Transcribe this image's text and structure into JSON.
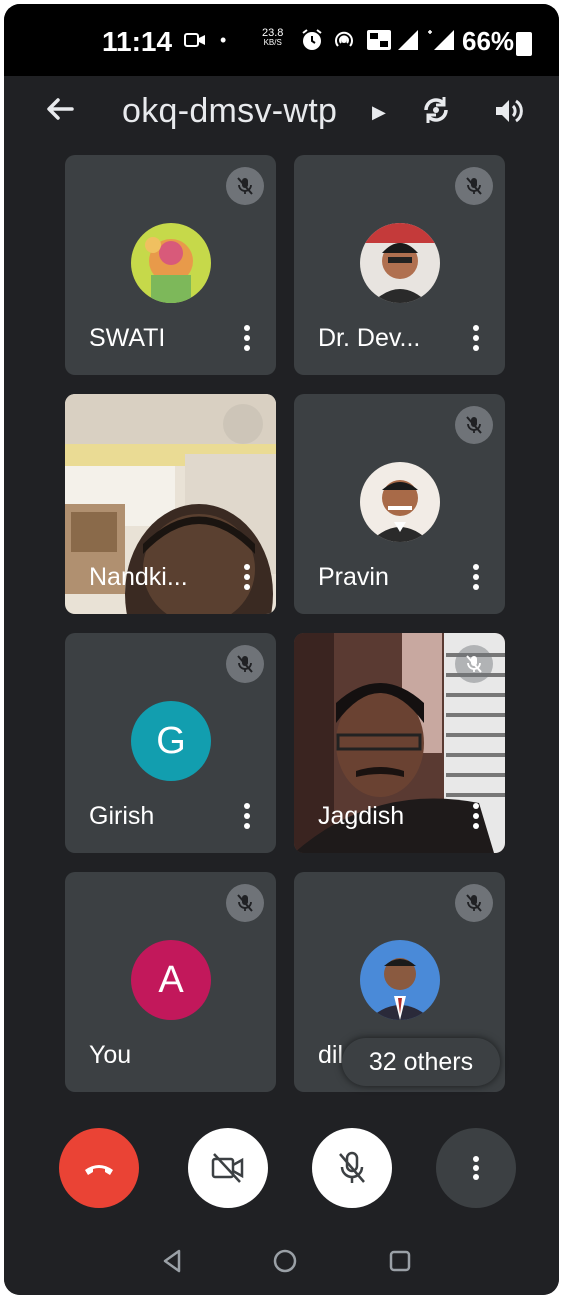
{
  "status_bar": {
    "time": "11:14",
    "speed_value": "23.8",
    "speed_unit": "KB/S",
    "battery": "66%"
  },
  "header": {
    "meeting_code": "okq-dmsv-wtp"
  },
  "participants": [
    {
      "name": "SWATI",
      "avatar_type": "photo",
      "muted": true
    },
    {
      "name": "Dr. Dev...",
      "avatar_type": "photo",
      "muted": true
    },
    {
      "name": "Nandki...",
      "avatar_type": "video",
      "muted": false
    },
    {
      "name": "Pravin",
      "avatar_type": "photo",
      "muted": true
    },
    {
      "name": "Girish",
      "avatar_type": "letter",
      "letter": "G",
      "color": "#129eaf",
      "muted": true
    },
    {
      "name": "Jagdish",
      "avatar_type": "video",
      "muted": true
    },
    {
      "name": "You",
      "avatar_type": "letter",
      "letter": "A",
      "color": "#c2185b",
      "muted": true
    },
    {
      "name": "dil",
      "avatar_type": "photo",
      "muted": true
    }
  ],
  "others_pill": "32 others",
  "controls": {
    "end_call_color": "#ea4335",
    "camera_state": "off",
    "mic_state": "off"
  },
  "icons": {
    "back": "arrow-left-icon",
    "switch_camera": "switch-camera-icon",
    "speaker": "speaker-icon",
    "mute": "mic-off-icon",
    "more": "more-vert-icon"
  }
}
